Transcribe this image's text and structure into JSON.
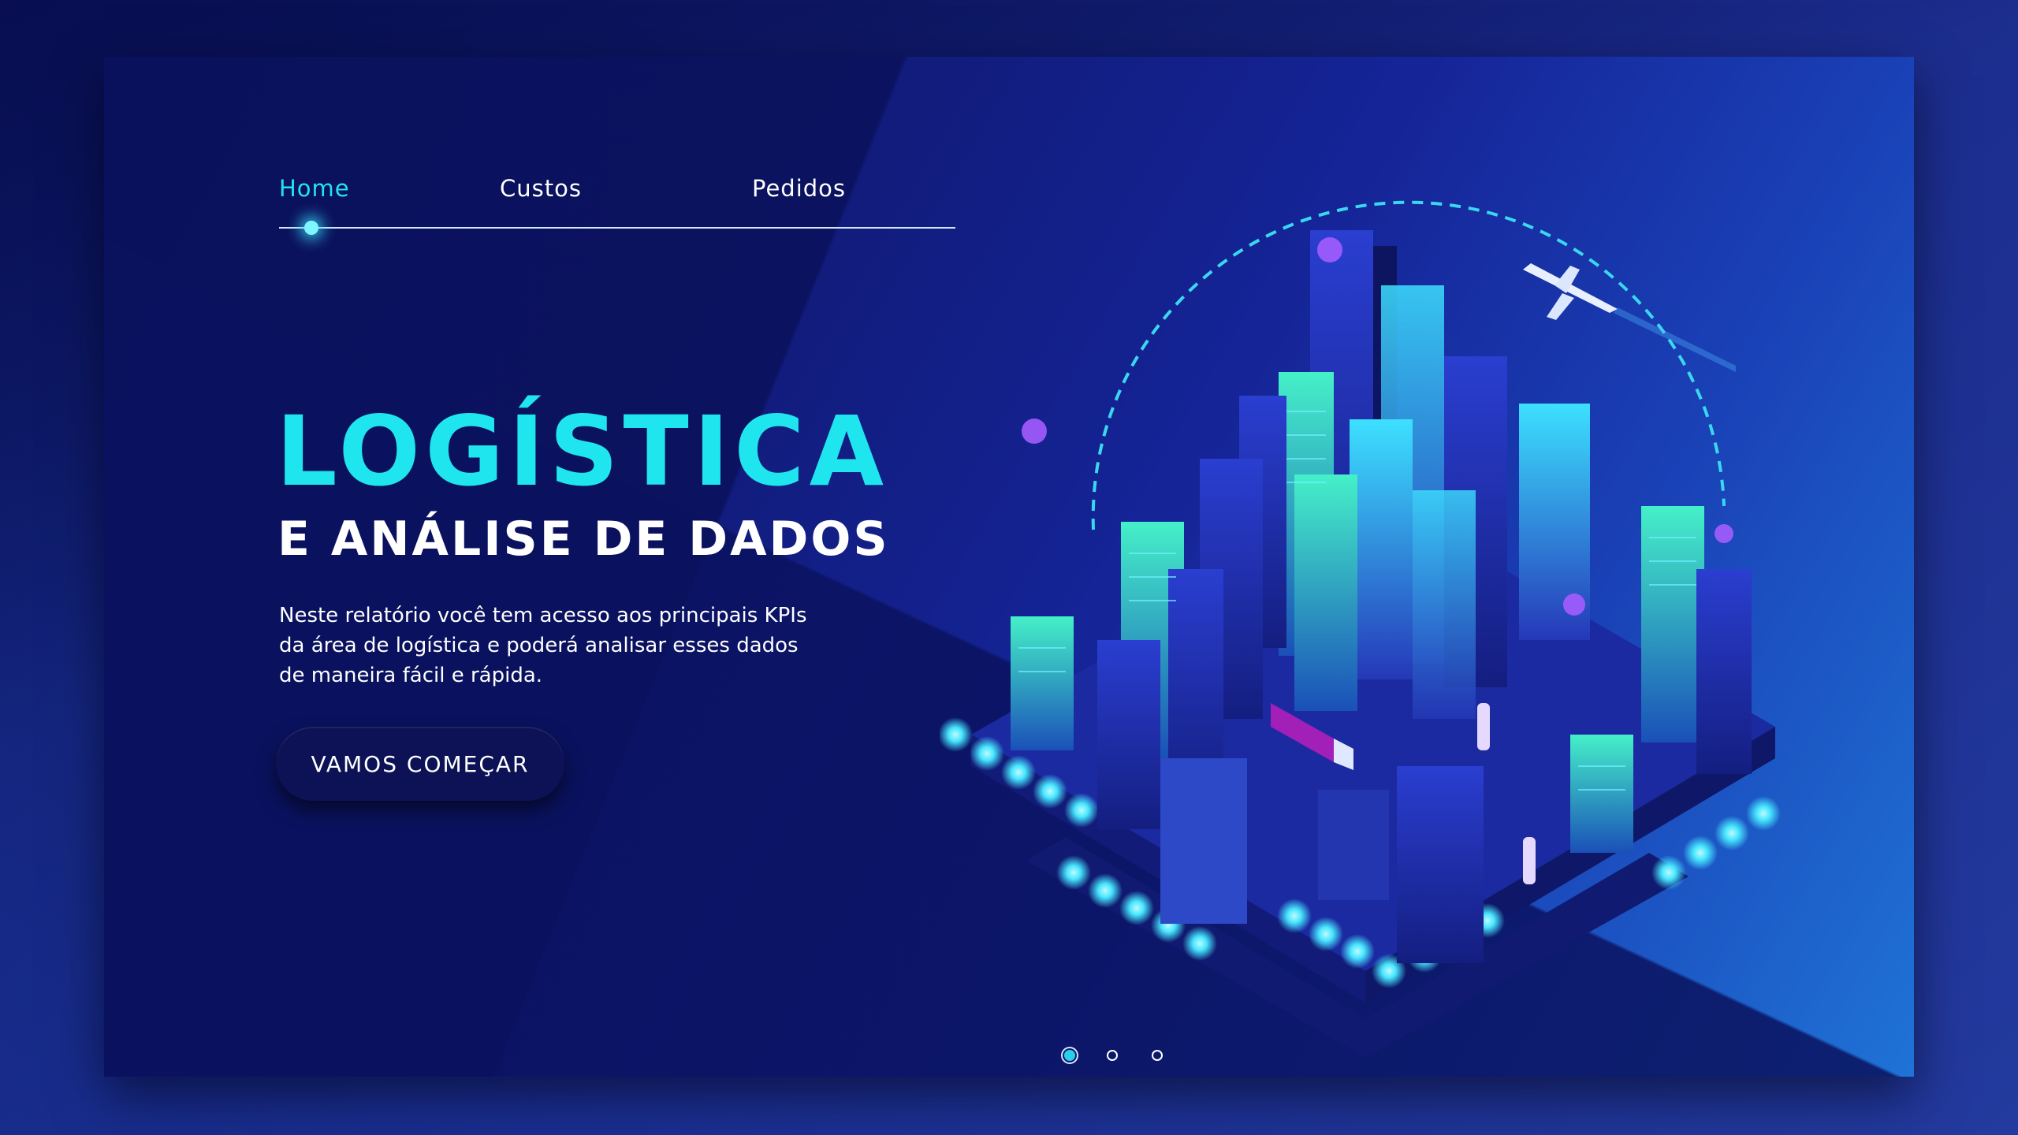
{
  "nav": {
    "items": [
      {
        "label": "Home",
        "active": true
      },
      {
        "label": "Custos",
        "active": false
      },
      {
        "label": "Pedidos",
        "active": false
      }
    ]
  },
  "hero": {
    "title": "LOGÍSTICA",
    "subtitle": "E ANÁLISE DE DADOS",
    "description_lines": [
      "Neste relatório você tem acesso aos principais KPIs",
      "da área de logística e poderá analisar esses dados",
      "de maneira fácil e rápida."
    ],
    "cta_label": "VAMOS COMEÇAR"
  },
  "pager": {
    "count": 3,
    "active_index": 0
  },
  "illustration": {
    "name": "isometric-smart-city-illustration"
  },
  "colors": {
    "accent_cyan": "#1fe6ee",
    "background_navy": "#0d1670",
    "button_bg": "#0c1255"
  }
}
